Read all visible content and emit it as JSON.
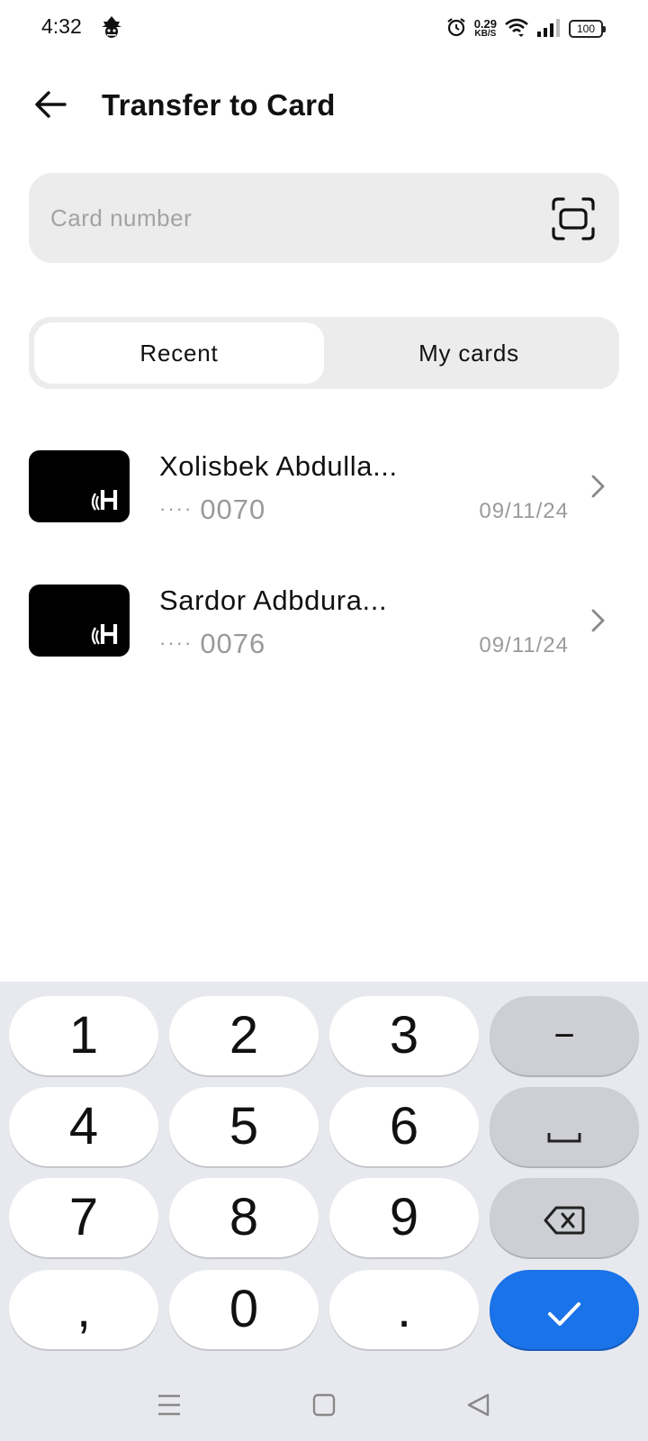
{
  "status_bar": {
    "time": "4:32",
    "app_icon": "incognito-icon",
    "net_speed_value": "0.29",
    "net_speed_unit": "KB/S",
    "battery": "100",
    "icons": [
      "alarm-icon",
      "wifi-icon",
      "signal-icon",
      "battery-icon"
    ]
  },
  "header": {
    "title": "Transfer to Card",
    "back_icon": "arrow-left-icon"
  },
  "card_input": {
    "placeholder": "Card number",
    "value": "",
    "scan_icon": "scan-frame-icon"
  },
  "tabs": [
    {
      "label": "Recent",
      "active": true
    },
    {
      "label": "My cards",
      "active": false
    }
  ],
  "recent": [
    {
      "name": "Xolisbek Abdulla...",
      "mask": "····",
      "last4": "0070",
      "date": "09/11/24",
      "card_icon": "humo-card-icon"
    },
    {
      "name": "Sardor Adbdura...",
      "mask": "····",
      "last4": "0076",
      "date": "09/11/24",
      "card_icon": "humo-card-icon"
    }
  ],
  "keyboard": {
    "keys": [
      "1",
      "2",
      "3",
      "4",
      "5",
      "6",
      "7",
      "8",
      "9",
      ",",
      "0",
      "."
    ],
    "minus": "−",
    "space_icon": "space-bar-icon",
    "backspace_icon": "backspace-icon",
    "confirm_icon": "check-icon"
  },
  "colors": {
    "accent": "#1a73e8",
    "input_bg": "#ececec",
    "keyboard_bg": "#e8e9ee",
    "gray_key": "#cdcfd5",
    "muted_text": "#9a9a9a"
  },
  "nav_bar": [
    "menu-icon",
    "home-square-icon",
    "back-triangle-icon"
  ]
}
